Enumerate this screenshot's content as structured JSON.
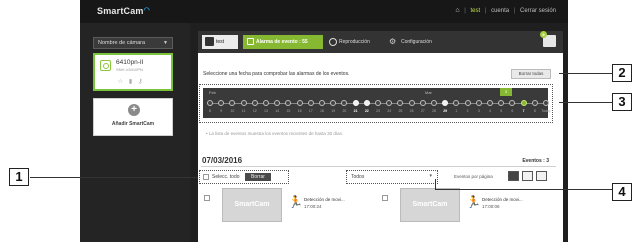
{
  "brand": {
    "name": "SmartCam"
  },
  "topnav": {
    "home_icon": "home-icon",
    "user": "test",
    "account": "cuenta",
    "logout": "Cerrar sesión"
  },
  "sidebar": {
    "camera_select": "Nombre de cámara",
    "camera": {
      "name": "6410pn-II",
      "model": "SNH-V6410PN"
    },
    "add_label": "Añadir SmartCam"
  },
  "tabs": {
    "camera": "test",
    "events": "Alarma de evento : 55",
    "playback": "Reproducción",
    "config": "Configuración",
    "bell_badge": "8"
  },
  "main": {
    "instructions": "Seleccione una fecha para comprobar las alarmas de los eventos.",
    "clear_all": "Borrar todas",
    "note": "• La lista de eventos muestra los eventos recientes de hasta 30 días.",
    "date": "07/03/2016",
    "events_count": "Eventos : 3",
    "select_all": "Selecc. todo",
    "delete": "Borrar",
    "filter": "Todos",
    "per_page": "Eventos por página"
  },
  "timeline": {
    "months": [
      "Feb",
      "Mar"
    ],
    "days": [
      "8",
      "9",
      "10",
      "11",
      "12",
      "13",
      "14",
      "15",
      "16",
      "17",
      "18",
      "19",
      "20",
      "21",
      "22",
      "23",
      "24",
      "25",
      "26",
      "27",
      "28",
      "29",
      "1",
      "2",
      "3",
      "4",
      "5",
      "6",
      "7",
      "8",
      "Today"
    ],
    "days_with_events": [
      "21",
      "22",
      "29",
      "7"
    ],
    "selected_day": "7",
    "flag": "3"
  },
  "events": [
    {
      "title": "Detección de movi...",
      "time": "17:00:24",
      "thumb": "SmartCam"
    },
    {
      "title": "Detección de movi...",
      "time": "17:00:06",
      "thumb": "SmartCam"
    }
  ],
  "callouts": [
    "1",
    "2",
    "3",
    "4"
  ]
}
